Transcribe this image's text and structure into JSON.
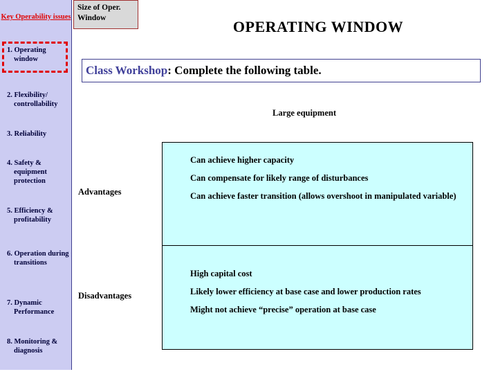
{
  "sidebar": {
    "heading": "Key Operability issues",
    "items": [
      {
        "label": "1. Operating window",
        "highlighted": true
      },
      {
        "label": "2. Flexibility/ controllability",
        "highlighted": false
      },
      {
        "label": "3. Reliability",
        "highlighted": false
      },
      {
        "label": "4. Safety & equipment protection",
        "highlighted": false
      },
      {
        "label": "5. Efficiency & profitability",
        "highlighted": false
      },
      {
        "label": "6. Operation during transitions",
        "highlighted": false
      },
      {
        "label": "7. Dynamic Performance",
        "highlighted": false
      },
      {
        "label": "8. Monitoring & diagnosis",
        "highlighted": false
      }
    ],
    "colors": {
      "background": "#ccccf2",
      "heading_text": "#e00000",
      "item_text": "#00003a",
      "highlight_border": "#e00000"
    }
  },
  "corner_box": {
    "line1": "Size of Oper.",
    "line2": "Window",
    "fill": "#d9d9d9",
    "border": "#a03030"
  },
  "header": {
    "title": "OPERATING WINDOW"
  },
  "workshop": {
    "label": "Class Workshop",
    "text": ": Complete the following table.",
    "label_color": "#40409a",
    "border_color": "#40408f"
  },
  "table": {
    "column_header": "Large equipment",
    "rows": [
      {
        "label": "Advantages",
        "items": [
          "Can achieve higher capacity",
          "Can compensate for likely range of disturbances",
          "Can achieve faster transition (allows overshoot in manipulated variable)"
        ]
      },
      {
        "label": "Disadvantages",
        "items": [
          "High capital cost",
          "Likely lower efficiency at base case and lower production rates",
          "Might not achieve “precise” operation at base case"
        ]
      }
    ],
    "cell_fill": "#ccffff",
    "cell_border": "#000000"
  }
}
